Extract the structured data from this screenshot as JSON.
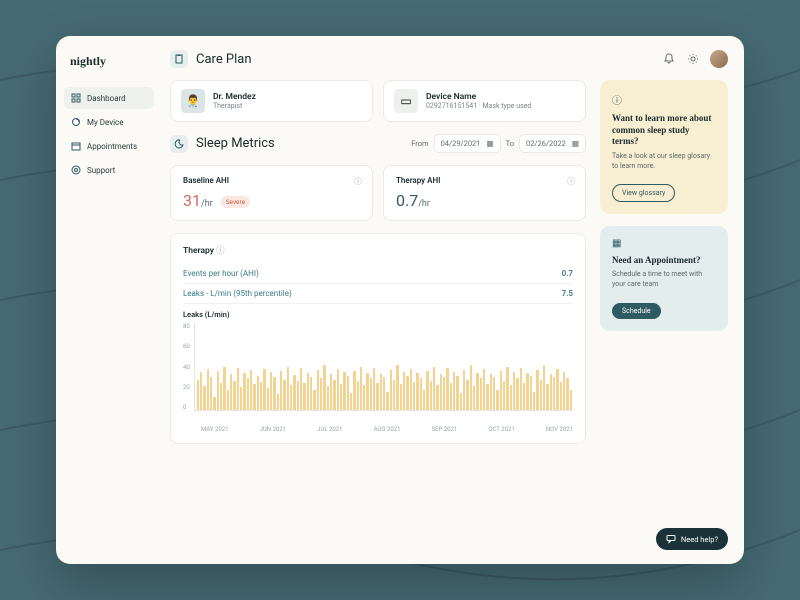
{
  "brand": "nightly",
  "nav": {
    "dashboard": "Dashboard",
    "device": "My Device",
    "appointments": "Appointments",
    "support": "Support"
  },
  "care_plan": {
    "title": "Care Plan",
    "doctor": {
      "name": "Dr. Mendez",
      "role": "Therapist"
    },
    "device": {
      "name": "Device Name",
      "sub": "0292716151541 · Mask type used"
    }
  },
  "sleep_metrics": {
    "title": "Sleep Metrics",
    "from_label": "From",
    "from_date": "04/29/2021",
    "to_label": "To",
    "to_date": "02/26/2022",
    "baseline": {
      "label": "Baseline AHI",
      "value": "31",
      "unit": "/hr",
      "severity": "Severe"
    },
    "therapy": {
      "label": "Therapy AHI",
      "value": "0.7",
      "unit": "/hr"
    }
  },
  "therapy_card": {
    "title": "Therapy",
    "rows": [
      {
        "k": "Events per hour (AHI)",
        "v": "0.7"
      },
      {
        "k": "Leaks - L/min (95th percentile)",
        "v": "7.5"
      }
    ]
  },
  "chart_data": {
    "type": "bar",
    "title": "Leaks (L/min)",
    "ylabel": "",
    "ylim": [
      0,
      80
    ],
    "yticks": [
      0,
      20,
      40,
      60,
      80
    ],
    "categories": [
      "MAY 2021",
      "JUN 2021",
      "JUL 2021",
      "AUG 2021",
      "SEP 2021",
      "OCT 2021",
      "NOV 2021"
    ],
    "values": [
      28,
      35,
      22,
      38,
      30,
      12,
      36,
      25,
      40,
      18,
      33,
      27,
      39,
      21,
      34,
      29,
      37,
      24,
      31,
      26,
      38,
      20,
      35,
      30,
      15,
      36,
      28,
      40,
      23,
      32,
      27,
      39,
      25,
      34,
      30,
      18,
      37,
      29,
      41,
      22,
      33,
      28,
      38,
      24,
      35,
      31,
      16,
      36,
      27,
      40,
      23,
      34,
      29,
      39,
      25,
      33,
      30,
      17,
      37,
      28,
      41,
      24,
      35,
      31,
      38,
      26,
      34,
      29,
      18,
      36,
      27,
      40,
      23,
      33,
      30,
      39,
      25,
      35,
      31,
      16,
      37,
      28,
      41,
      22,
      34,
      29,
      38,
      24,
      33,
      30,
      18,
      36,
      27,
      40,
      23,
      35,
      29,
      39,
      25,
      34,
      31,
      17,
      37,
      28,
      41,
      24,
      33,
      30,
      38,
      26,
      35,
      29,
      18
    ]
  },
  "promos": {
    "glossary": {
      "title": "Want to learn more about common sleep study terms?",
      "text": "Take a look at our sleep glosary to learn more.",
      "cta": "View glossary"
    },
    "appointment": {
      "title": "Need an Appointment?",
      "text": "Schedule a time to meet with your care team",
      "cta": "Schedule"
    }
  },
  "help": "Need help?"
}
